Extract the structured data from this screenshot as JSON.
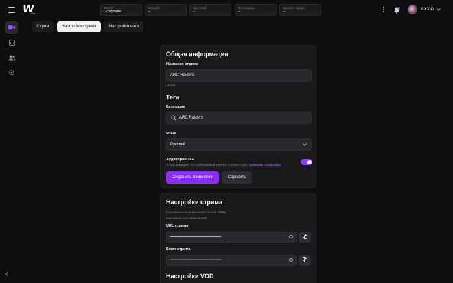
{
  "brand": {
    "logo_letter": "W",
    "logo_sub": "ritch"
  },
  "stats": [
    {
      "label": "Статус",
      "value": "Оффлайн"
    },
    {
      "label": "Битрейт",
      "value": "–"
    },
    {
      "label": "Зрителей",
      "value": "–"
    },
    {
      "label": "Фолловеры",
      "value": "–"
    },
    {
      "label": "Время в эфире",
      "value": "–"
    }
  ],
  "user": {
    "name": "AXXID"
  },
  "tabs": [
    "Стрим",
    "Настройки стрима",
    "Настройки чата"
  ],
  "general": {
    "title": "Общая информация",
    "stream_name_label": "Название стрима",
    "stream_name_value": "ARC Raiders",
    "counter": "11/100",
    "tags_title": "Теги",
    "category_label": "Категория",
    "category_value": "ARC Raiders",
    "language_label": "Язык",
    "language_value": "Русский",
    "audience_label": "Аудитория 18+",
    "audience_desc": "Я подтверждаю, что публикуемый контент соответствует",
    "audience_link": "правилам платформы",
    "audience_on": true,
    "save_label": "Сохранить изменения",
    "reset_label": "Сбросить"
  },
  "stream_settings": {
    "title": "Настройки стрима",
    "max_resolution": "Максимальное разрешение потока 1080p",
    "max_bitrate": "Максимальный bitrate 8.5Mb",
    "url_label": "URL стрима",
    "url_value": "••••••••••••••••••••••••••••••••••••••••••••••••••••••••••••",
    "key_label": "Ключ стрима",
    "key_value": "••••••••••••••••••••••••••••••••••••••••••••••••••••••••••••"
  },
  "vod": {
    "title": "Настройки VOD"
  },
  "colors": {
    "accent": "#8b2cf5",
    "bg": "#0e0e0f",
    "card": "#1a1a1c"
  }
}
